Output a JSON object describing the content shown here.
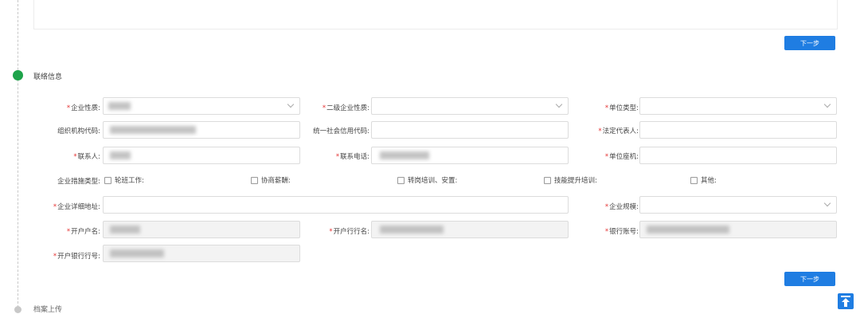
{
  "next_button_label": "下一步",
  "section_contact": {
    "title": "联络信息"
  },
  "form": {
    "enterprise_nature": {
      "label": "企业性质:",
      "required": true
    },
    "secondary_nature": {
      "label": "二级企业性质:",
      "required": true
    },
    "unit_type": {
      "label": "单位类型:",
      "required": true
    },
    "org_code": {
      "label": "组织机构代码:",
      "required": false
    },
    "credit_code": {
      "label": "统一社会信用代码:",
      "required": false
    },
    "legal_rep": {
      "label": "法定代表人:",
      "required": true
    },
    "contact_person": {
      "label": "联系人:",
      "required": true
    },
    "contact_phone": {
      "label": "联系电话:",
      "required": true
    },
    "unit_phone": {
      "label": "单位座机:",
      "required": true
    },
    "measures": {
      "label": "企业措施类型:",
      "options": [
        "轮班工作:",
        "协商薪酬:",
        "转岗培训、安置:",
        "技能提升培训:",
        "其他:"
      ]
    },
    "address": {
      "label": "企业详细地址:",
      "required": true
    },
    "scale": {
      "label": "企业规模:",
      "required": true
    },
    "account_name": {
      "label": "开户户名:",
      "required": true
    },
    "bank_name": {
      "label": "开户行行名:",
      "required": true
    },
    "account_no": {
      "label": "银行账号:",
      "required": true
    },
    "bank_code": {
      "label": "开户银行行号:",
      "required": true
    }
  },
  "section_archive": {
    "title": "档案上传"
  },
  "colors": {
    "primary": "#1f7de2",
    "active_dot": "#1ea34a",
    "inactive_dot": "#c8c8c8",
    "required": "#e53333"
  },
  "icons": {
    "back_to_top": "back-to-top-icon",
    "dropdown": "chevron-down-icon"
  }
}
